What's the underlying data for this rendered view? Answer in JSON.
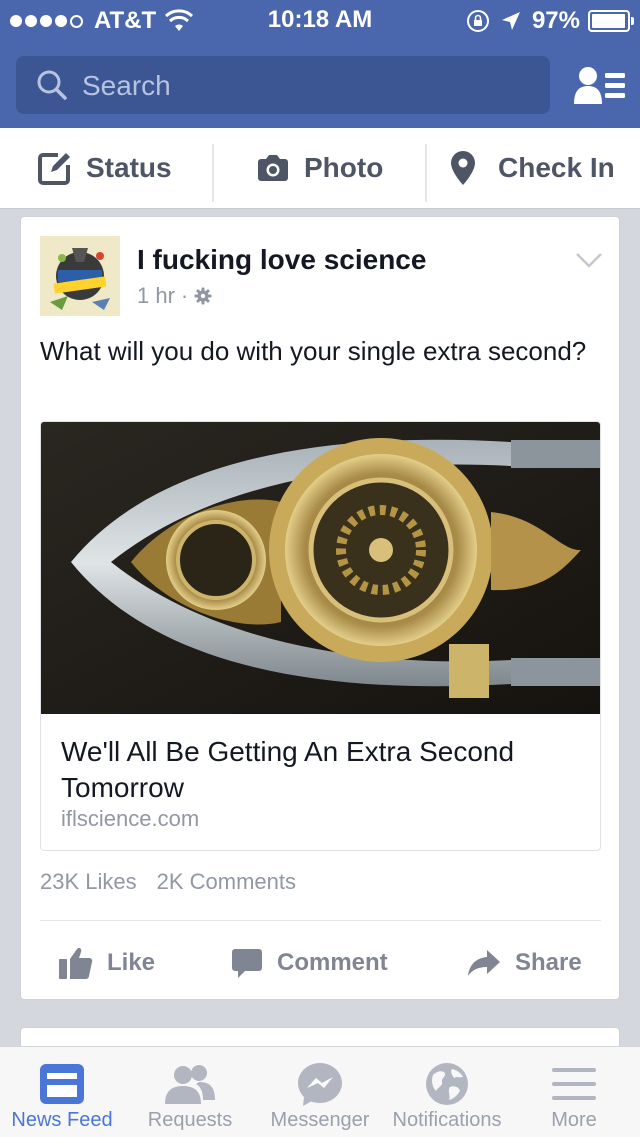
{
  "status_bar": {
    "carrier": "AT&T",
    "time": "10:18 AM",
    "battery": "97%",
    "signal_bars_filled": 4,
    "signal_bars_total": 5
  },
  "search": {
    "placeholder": "Search"
  },
  "publisher": {
    "status_label": "Status",
    "photo_label": "Photo",
    "checkin_label": "Check In"
  },
  "story": {
    "author": "I fucking love science",
    "time": "1 hr",
    "separator": "·",
    "text": "What will you do with your single extra second?",
    "link": {
      "title": "We'll All Be Getting An Extra Second Tomorrow",
      "domain": "iflscience.com"
    },
    "likes": "23K Likes",
    "comments": "2K Comments",
    "actions": {
      "like": "Like",
      "comment": "Comment",
      "share": "Share"
    }
  },
  "tabs": [
    {
      "label": "News Feed",
      "icon": "news-feed-icon",
      "active": true
    },
    {
      "label": "Requests",
      "icon": "friend-requests-icon",
      "active": false
    },
    {
      "label": "Messenger",
      "icon": "messenger-icon",
      "active": false
    },
    {
      "label": "Notifications",
      "icon": "globe-icon",
      "active": false
    },
    {
      "label": "More",
      "icon": "hamburger-icon",
      "active": false
    }
  ],
  "colors": {
    "brand_blue": "#4a67ad",
    "search_bg": "#3c5694",
    "active_tab": "#4a76d8",
    "muted_text": "#9197a3"
  }
}
